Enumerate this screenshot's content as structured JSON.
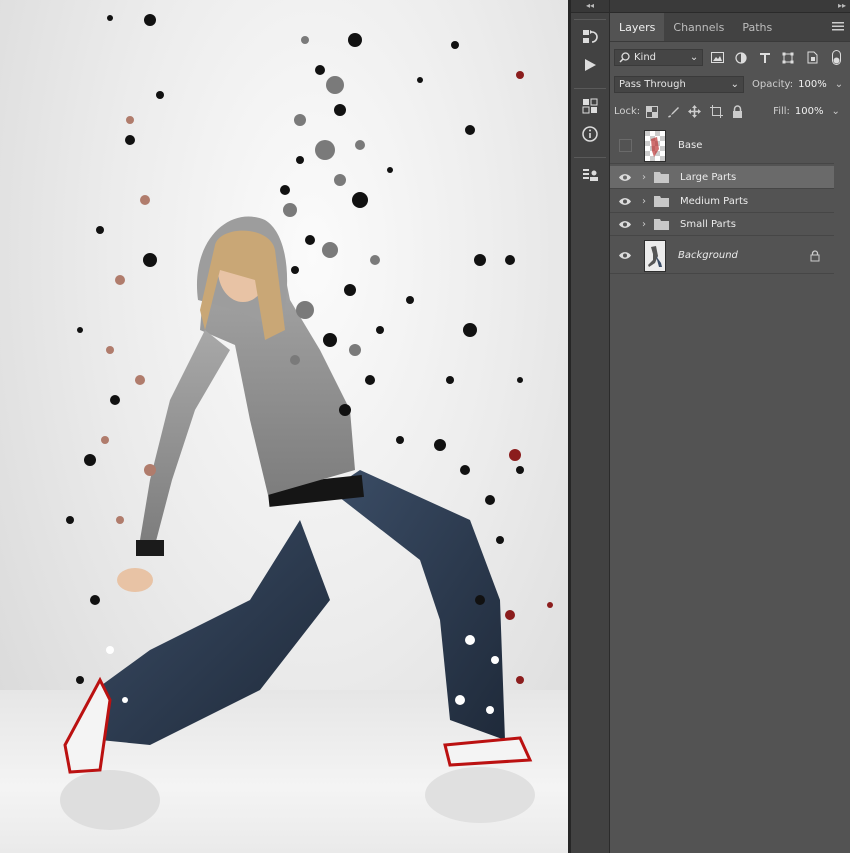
{
  "panel": {
    "tabs": [
      "Layers",
      "Channels",
      "Paths"
    ],
    "active_tab": "Layers",
    "filter_kind": "Kind",
    "blend_mode": "Pass Through",
    "opacity_label": "Opacity:",
    "opacity_value": "100%",
    "lock_label": "Lock:",
    "fill_label": "Fill:",
    "fill_value": "100%",
    "layers": [
      {
        "name": "Base",
        "visible": false,
        "type": "pixel"
      },
      {
        "name": "Large Parts",
        "visible": true,
        "type": "group",
        "selected": true
      },
      {
        "name": "Medium Parts",
        "visible": true,
        "type": "group"
      },
      {
        "name": "Small Parts",
        "visible": true,
        "type": "group"
      },
      {
        "name": "Background",
        "visible": true,
        "type": "pixel",
        "locked": true
      }
    ]
  },
  "dock": {
    "icons": [
      "history-icon",
      "play-action-icon",
      "libraries-icon",
      "info-icon",
      "properties-icon"
    ]
  },
  "colors": {
    "panel_bg": "#535353",
    "dock_bg": "#424242",
    "selected_layer": "#6a6a6a",
    "canvas_bg": "#ececec"
  }
}
